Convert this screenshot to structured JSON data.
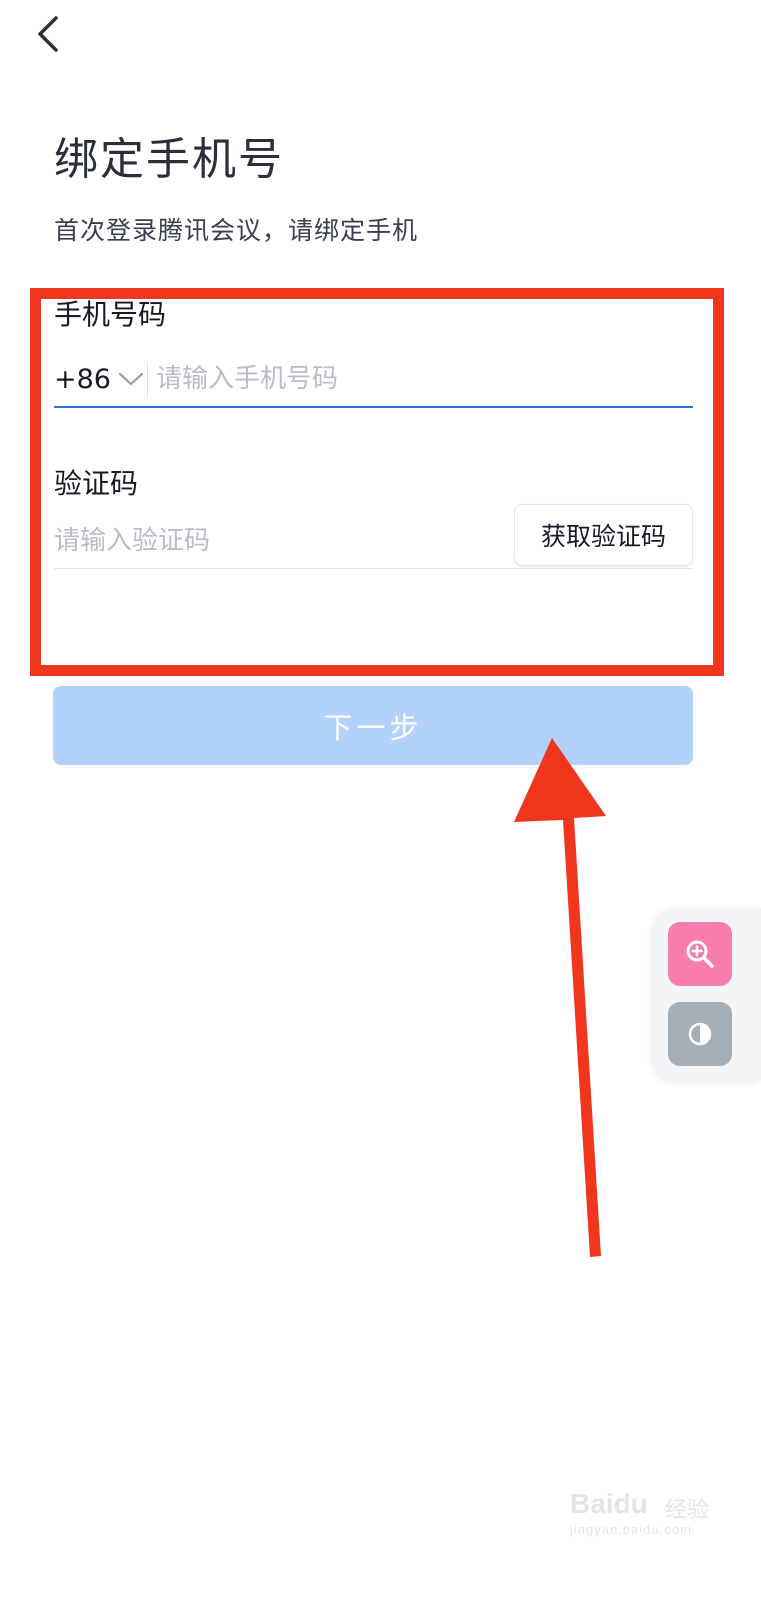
{
  "nav": {
    "back_icon": "chevron-left-icon"
  },
  "header": {
    "title": "绑定手机号",
    "subtitle": "首次登录腾讯会议，请绑定手机"
  },
  "form": {
    "phone": {
      "label": "手机号码",
      "country_code": "+86",
      "country_code_icon": "chevron-down-icon",
      "value": "",
      "placeholder": "请输入手机号码"
    },
    "code": {
      "label": "验证码",
      "value": "",
      "placeholder": "请输入验证码",
      "get_code_label": "获取验证码"
    },
    "next_label": "下一步"
  },
  "floating_tools": {
    "zoom_icon": "zoom-in-icon",
    "contrast_icon": "contrast-icon"
  },
  "watermark": {
    "brand": "Baidu",
    "text": "经验",
    "url": "jingyan.baidu.com"
  },
  "colors": {
    "primary_disabled": "#b3d2fb",
    "input_focus": "#2f6fd8",
    "annotation": "#f0361d",
    "zoom_button": "#f77eaa",
    "contrast_button": "#a4aeb6"
  }
}
